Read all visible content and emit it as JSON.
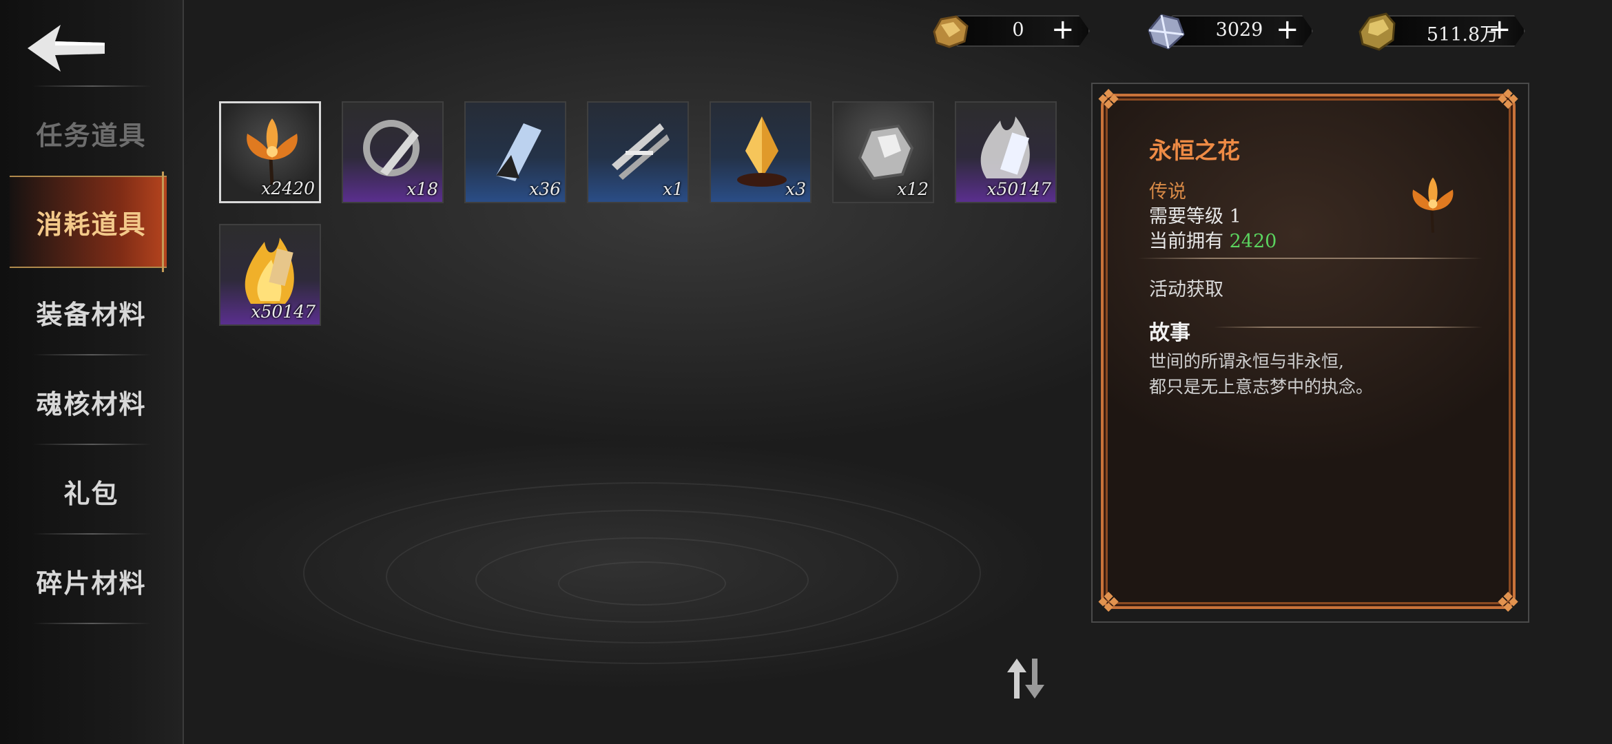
{
  "currencies": [
    {
      "icon": "gold-ore-icon",
      "value": "0",
      "plus": "+"
    },
    {
      "icon": "crystal-icon",
      "value": "3029",
      "plus": "+"
    },
    {
      "icon": "gold-nugget-icon",
      "value": "511.8万",
      "plus": "+"
    }
  ],
  "sidebar": {
    "items": [
      {
        "label": "任务道具"
      },
      {
        "label": "消耗道具"
      },
      {
        "label": "装备材料"
      },
      {
        "label": "魂核材料"
      },
      {
        "label": "礼包"
      },
      {
        "label": "碎片材料"
      }
    ]
  },
  "inventory": [
    {
      "icon": "eternal-flower-icon",
      "quality": "gold",
      "qty": "x2420"
    },
    {
      "icon": "silver-relic-icon",
      "quality": "purple",
      "qty": "x18"
    },
    {
      "icon": "blue-crystal-icon",
      "quality": "blue",
      "qty": "x36"
    },
    {
      "icon": "silver-shards-icon",
      "quality": "blue",
      "qty": "x1"
    },
    {
      "icon": "amber-crystal-icon",
      "quality": "blue",
      "qty": "x3"
    },
    {
      "icon": "silver-ore-icon",
      "quality": "grey",
      "qty": "x12"
    },
    {
      "icon": "white-flame-ticket-icon",
      "quality": "purple",
      "qty": "x50147"
    },
    {
      "icon": "gold-flame-ticket-icon",
      "quality": "purple",
      "qty": "x50147"
    }
  ],
  "detail": {
    "title": "永恒之花",
    "rarity": "传说",
    "req_label": "需要等级",
    "req_value": "1",
    "own_label": "当前拥有",
    "own_value": "2420",
    "source": "活动获取",
    "story_title": "故事",
    "story_line1": "世间的所谓永恒与非永恒,",
    "story_line2": "都只是无上意志梦中的执念。"
  },
  "colors": {
    "accent_orange": "#ef8b45",
    "owned_green": "#5bd45f",
    "active_tab": "#f3c98a"
  }
}
